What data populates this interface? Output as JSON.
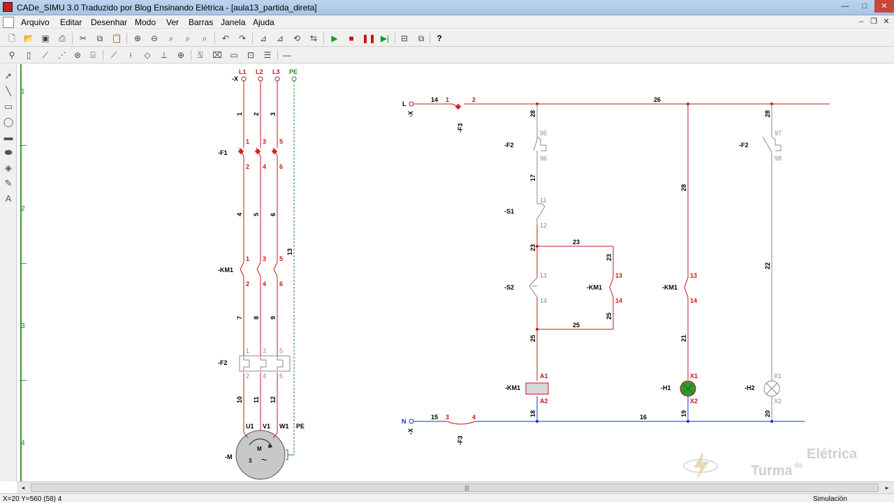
{
  "window": {
    "title": "CADe_SIMU 3.0 Traduzido por Blog Ensinando Elétrica - [aula13_partida_direta]",
    "controls": {
      "minimize": "—",
      "maximize": "□",
      "close": "✕"
    }
  },
  "menu": [
    "Arquivo",
    "Editar",
    "Desenhar",
    "Modo",
    "Ver",
    "Barras",
    "Janela",
    "Ajuda"
  ],
  "toolbar1": [
    "new-file",
    "open-folder",
    "save",
    "print",
    "cut",
    "copy",
    "paste",
    "zoom-in",
    "zoom-out",
    "zoom-fit",
    "zoom-area",
    "undo",
    "redo",
    "mirror-h",
    "mirror-v",
    "rotate",
    "flip",
    "sim-play",
    "sim-stop",
    "sim-pause",
    "sim-step",
    "window-tile",
    "window-cascade",
    "help"
  ],
  "toolbar2": [
    "terminal",
    "fuse",
    "breaker",
    "thermal",
    "motor",
    "transformer",
    "contact-no",
    "contact-nc",
    "diode",
    "coil",
    "lamp",
    "timer",
    "relay",
    "button",
    "line"
  ],
  "left_tools": [
    "pointer",
    "line",
    "rectangle",
    "ellipse",
    "filled-rect",
    "filled-ellipse",
    "fill",
    "pen",
    "text-A"
  ],
  "ruler_numbers": [
    "1",
    "2",
    "3",
    "4"
  ],
  "colors": {
    "red": "#c8161d",
    "blue": "#1a2bd6",
    "green": "#1f8a1f",
    "gray": "#7a7a7a",
    "lamp_on": "#2f9a2f"
  },
  "power": {
    "phases": [
      "L1",
      "L2",
      "L3",
      "PE"
    ],
    "terminal": "-X",
    "wires_top": [
      "1",
      "2",
      "3"
    ],
    "f1_label": "-F1",
    "f1_top": [
      "1",
      "3",
      "5"
    ],
    "f1_bot": [
      "2",
      "4",
      "6"
    ],
    "wires_mid": [
      "4",
      "5",
      "6"
    ],
    "pe_wire": "13",
    "km1_label": "-KM1",
    "km1_top": [
      "1",
      "3",
      "5"
    ],
    "km1_bot": [
      "2",
      "4",
      "6"
    ],
    "wires_lower": [
      "7",
      "8",
      "9"
    ],
    "f2_label": "-F2",
    "f2_top": [
      "1",
      "3",
      "5"
    ],
    "f2_bot": [
      "2",
      "4",
      "6"
    ],
    "wires_motor": [
      "10",
      "11",
      "12"
    ],
    "motor_terms": [
      "U1",
      "V1",
      "W1",
      "PE"
    ],
    "motor_label": "-M",
    "motor_m": "M",
    "motor_3": "3",
    "motor_sym": "~"
  },
  "control": {
    "L_term": "L",
    "L_x": "-X",
    "N_term": "N",
    "N_x": "-X",
    "w14": "14",
    "f3_top_label": "-F3",
    "f3_top_nums": [
      "1",
      "2"
    ],
    "w26": "26",
    "w28a": "28",
    "w28b": "28",
    "w28c": "28",
    "f2_95": "95",
    "f2_96": "96",
    "f2_97": "97",
    "f2_98": "98",
    "f2_label1": "-F2",
    "f2_label2": "-F2",
    "w17": "17",
    "s1_label": "-S1",
    "s1_nums": [
      "11",
      "12"
    ],
    "w23a": "23",
    "w23b": "23",
    "w23c": "23",
    "s2_label": "-S2",
    "s2_nums": [
      "13",
      "14"
    ],
    "km1_aux_label": "-KM1",
    "km1_aux_nums": [
      "13",
      "14"
    ],
    "w25a": "25",
    "w25b": "25",
    "w25c": "25",
    "km1_coil_label": "-KM1",
    "km1_coil_nums": [
      "A1",
      "A2"
    ],
    "w18": "18",
    "km1_sig_label": "-KM1",
    "km1_sig_nums": [
      "13",
      "14"
    ],
    "w21": "21",
    "h1_label": "-H1",
    "h1_nums": [
      "X1",
      "X2"
    ],
    "w19": "19",
    "w22": "22",
    "h2_label": "-H2",
    "h2_nums": [
      "X1",
      "X2"
    ],
    "w20": "20",
    "w15": "15",
    "f3_bot_label": "-F3",
    "f3_bot_nums": [
      "3",
      "4"
    ],
    "w16": "16"
  },
  "logo": {
    "word1": "Elétrica",
    "word2": "Turma",
    "word3": "da"
  },
  "status": {
    "coords": "X=20  Y=560 (58) 4",
    "mode": "Simulación"
  }
}
